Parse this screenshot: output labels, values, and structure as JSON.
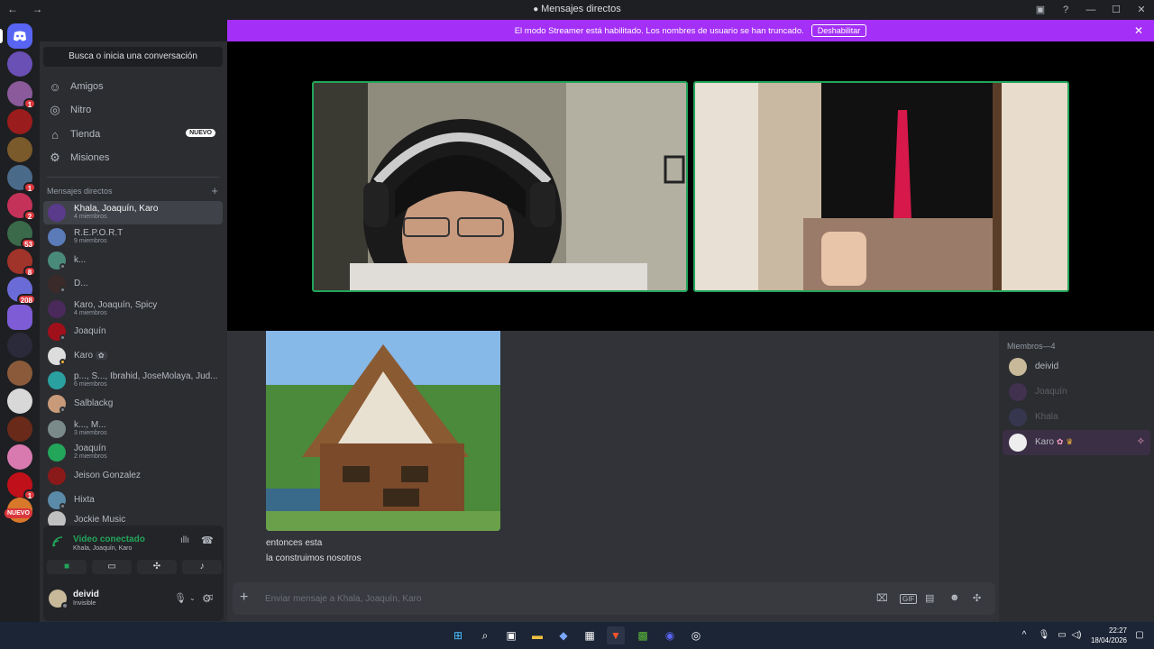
{
  "window": {
    "title": "Mensajes directos",
    "nav": "← →"
  },
  "banner": {
    "text": "El modo Streamer está habilitado. Los nombres de usuario se han truncado.",
    "button": "Deshabilitar"
  },
  "sidebar": {
    "search": "Busca o inicia una conversación",
    "nav": [
      {
        "label": "Amigos",
        "icon": "friends-icon"
      },
      {
        "label": "Nitro",
        "icon": "nitro-icon"
      },
      {
        "label": "Tienda",
        "icon": "shop-icon",
        "tag": "NUEVO"
      },
      {
        "label": "Misiones",
        "icon": "quests-icon"
      }
    ],
    "dm_header": "Mensajes directos",
    "dms": [
      {
        "name": "Khala, Joaquín, Karo",
        "sub": "4 miembros"
      },
      {
        "name": "R.E.P.O.R.T",
        "sub": "9 miembros"
      },
      {
        "name": "k..."
      },
      {
        "name": "D..."
      },
      {
        "name": "Karo, Joaquín, Spicy",
        "sub": "4 miembros"
      },
      {
        "name": "Joaquín"
      },
      {
        "name": "Karo"
      },
      {
        "name": "p..., S..., Ibrahid, JoseMolaya, Jud...",
        "sub": "6 miembros"
      },
      {
        "name": "Salblackg"
      },
      {
        "name": "k..., M...",
        "sub": "3 miembros"
      },
      {
        "name": "Joaquín",
        "sub": "2 miembros"
      },
      {
        "name": "Jeison Gonzalez"
      },
      {
        "name": "Hixta"
      },
      {
        "name": "Jockie Music"
      }
    ]
  },
  "servers": {
    "badges": [
      "1",
      "1",
      "2",
      "53",
      "8",
      "208",
      "1"
    ],
    "new_label": "NUEVO"
  },
  "voice": {
    "title": "Video conectado",
    "channel": "Khala, Joaquín, Karo"
  },
  "user": {
    "name": "deivid",
    "status": "Invisible"
  },
  "chat": {
    "messages": [
      "entonces esta",
      "la construimos nosotros"
    ],
    "placeholder": "Enviar mensaje a Khala, Joaquín, Karo"
  },
  "members": {
    "header": "Miembros—4",
    "list": [
      {
        "name": "deivid"
      },
      {
        "name": "Joaquín"
      },
      {
        "name": "Khala"
      },
      {
        "name": "Karo"
      }
    ]
  },
  "taskbar": {
    "time": "22:27",
    "date": "18/04/2026"
  },
  "colors": {
    "accent": "#5865f2",
    "banner": "#a42ff6",
    "online": "#23a55a",
    "badge": "#da373c"
  }
}
